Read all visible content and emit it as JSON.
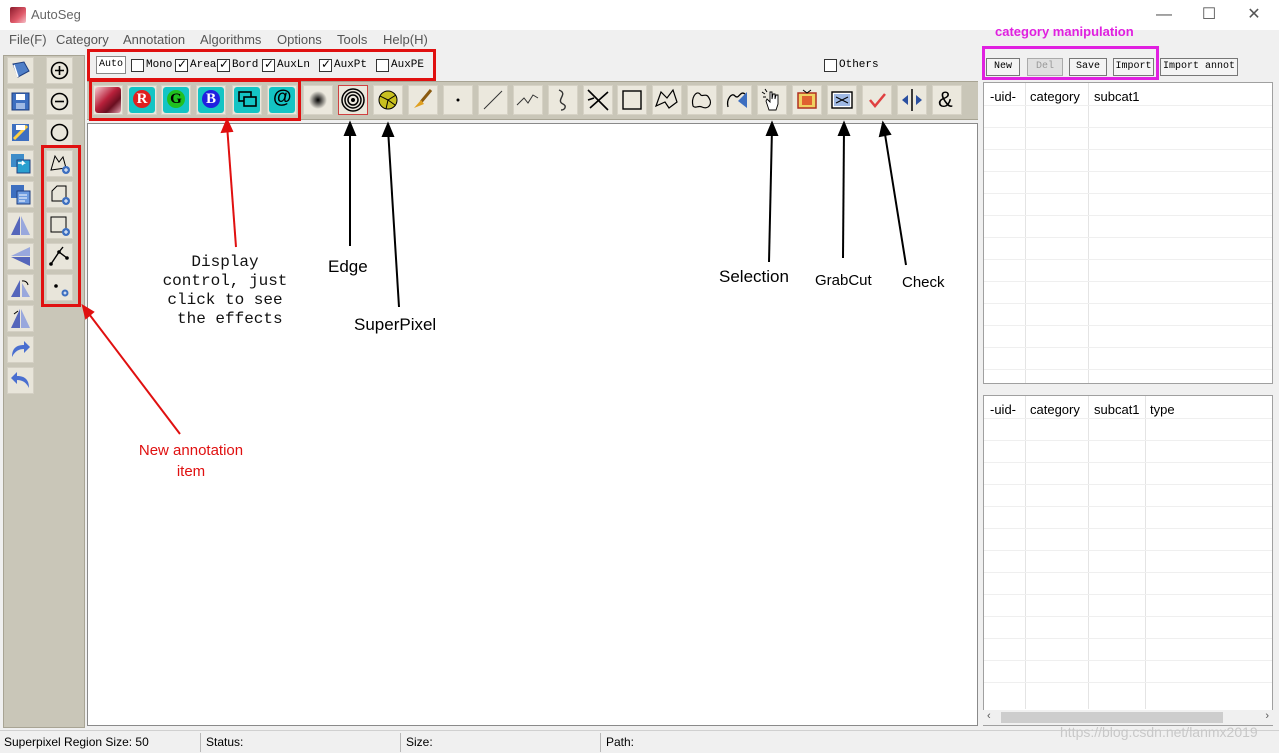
{
  "window": {
    "title": "AutoSeg",
    "minimize": "—",
    "maximize": "☐",
    "close": "✕"
  },
  "menu": [
    "File(F)",
    "Category",
    "Annotation",
    "Algorithms",
    "Options",
    "Tools",
    "Help(H)"
  ],
  "display_bar": {
    "auto_label": "Auto",
    "checkboxes": [
      {
        "label": "Mono",
        "checked": false
      },
      {
        "label": "Area",
        "checked": true
      },
      {
        "label": "Bord",
        "checked": true
      },
      {
        "label": "AuxLn",
        "checked": true
      },
      {
        "label": "AuxPt",
        "checked": true
      },
      {
        "label": "AuxPE",
        "checked": false
      }
    ],
    "others": {
      "label": "Others",
      "checked": false
    }
  },
  "icon_toolbar": {
    "letter_buttons": [
      "R",
      "G",
      "B",
      "@"
    ],
    "icons": [
      "image-icon",
      "r-channel-icon",
      "g-channel-icon",
      "b-channel-icon",
      "overlay-icon",
      "at-icon",
      "blur-icon",
      "edge-icon",
      "superpixel-icon",
      "brush-icon",
      "point-icon",
      "line-icon",
      "polyline-icon",
      "curve-icon",
      "cross-lines-icon",
      "rectangle-icon",
      "polygon-icon",
      "freehand-icon",
      "smart-polygon-icon",
      "selection-hand-icon",
      "grabcut-frame-icon",
      "grabcut-icon",
      "check-icon",
      "split-icon",
      "ampersand-icon"
    ],
    "ampersand": "&"
  },
  "left_toolbar": {
    "icons": [
      "open-icon",
      "save-icon",
      "edit-icon",
      "convert-icon",
      "copy-icon",
      "flip-icon",
      "mirror-icon",
      "rotate-icon",
      "transform-icon",
      "redo-icon",
      "undo-icon"
    ],
    "zoom_icons": [
      "zoom-in-icon",
      "zoom-out-icon",
      "zoom-fit-icon"
    ],
    "new_annotation_icons": [
      "new-polygon-icon",
      "new-region-icon",
      "new-rectangle-icon",
      "new-line-icon",
      "new-point-icon"
    ]
  },
  "annotations": {
    "display_control": "Display\ncontrol, just\nclick to see\n the effects",
    "edge": "Edge",
    "superpixel": "SuperPixel",
    "selection": "Selection",
    "grabcut": "GrabCut",
    "check": "Check",
    "new_annotation_item": "New annotation\nitem",
    "category_manipulation": "category manipulation"
  },
  "category_panel": {
    "buttons": [
      {
        "label": "New",
        "enabled": true
      },
      {
        "label": "Del",
        "enabled": false
      },
      {
        "label": "Save",
        "enabled": true
      },
      {
        "label": "Import",
        "enabled": true
      },
      {
        "label": "Import annot",
        "enabled": true
      }
    ],
    "category_table": {
      "columns": [
        "-uid-",
        "category",
        "subcat1"
      ],
      "rows": []
    },
    "annotation_table": {
      "columns": [
        "-uid-",
        "category",
        "subcat1",
        "type"
      ],
      "rows": []
    }
  },
  "status_bar": {
    "superpixel": "Superpixel Region Size: 50",
    "status": "Status:",
    "size": "Size:",
    "path": "Path:"
  },
  "watermark": "https://blog.csdn.net/lanmx2019",
  "colors": {
    "red_highlight": "#e01010",
    "magenta_highlight": "#e020e0",
    "toolbar_bg": "#c9c6b8"
  }
}
